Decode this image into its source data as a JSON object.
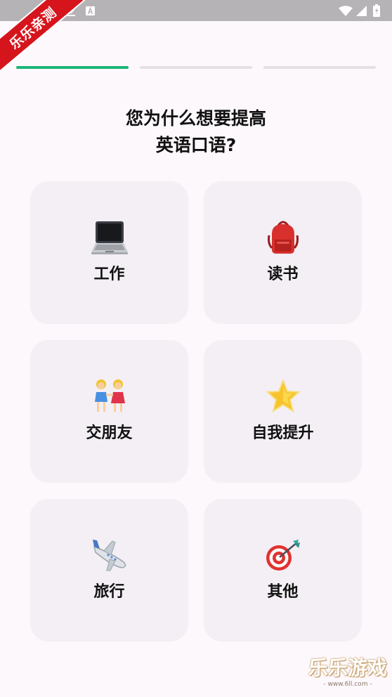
{
  "status_bar": {
    "icons": [
      "download-icon",
      "a-icon",
      "wifi-icon",
      "signal-icon",
      "battery-icon"
    ]
  },
  "ribbon": {
    "text": "乐乐亲测"
  },
  "progress": {
    "steps_total": 3,
    "current_step": 1,
    "active_color": "#1bb778",
    "inactive_color": "#e4e1e5"
  },
  "question": {
    "line1": "您为什么想要提高",
    "line2": "英语口语?"
  },
  "options": [
    {
      "label": "工作",
      "icon": "laptop-icon"
    },
    {
      "label": "读书",
      "icon": "backpack-icon"
    },
    {
      "label": "交朋友",
      "icon": "two-women-icon"
    },
    {
      "label": "自我提升",
      "icon": "star-icon"
    },
    {
      "label": "旅行",
      "icon": "airplane-icon"
    },
    {
      "label": "其他",
      "icon": "target-icon"
    }
  ],
  "watermark": {
    "title": "乐乐游戏",
    "url": "- www.6ll.com -"
  },
  "colors": {
    "background": "#fdf8fc",
    "card": "#f3eff4",
    "accent": "#1bb778",
    "ribbon": "#d6141c"
  }
}
